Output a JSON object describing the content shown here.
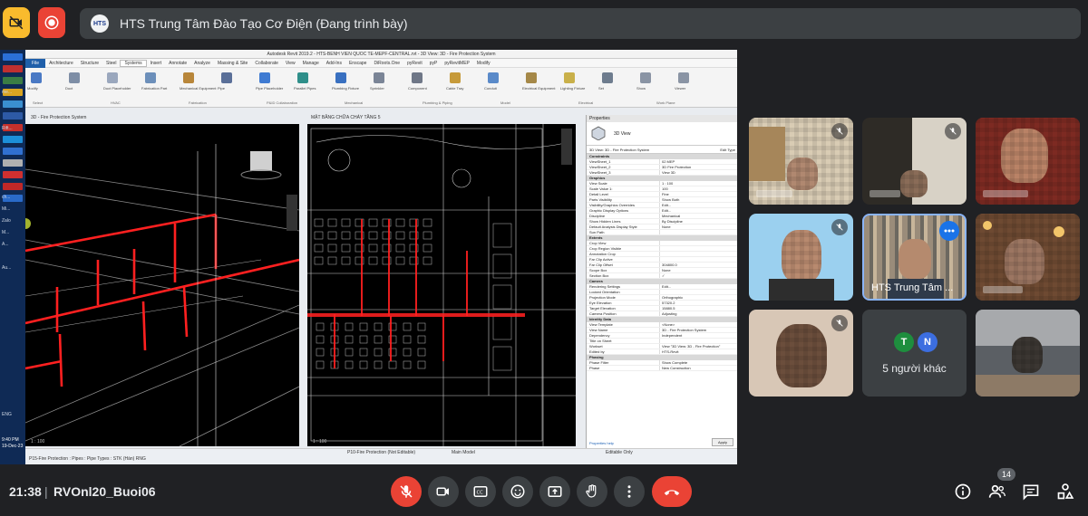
{
  "header": {
    "camera_off_icon": "camera-off-icon",
    "record_icon": "record-icon",
    "presenting_logo": "HTS",
    "presenting_title": "HTS Trung Tâm Đào Tạo Cơ Điện (Đang trình bày)"
  },
  "shared_screen": {
    "window_title": "Autodesk Revit 2019.2 - HTS-BENH VIEN QUOC TE-MEPF-CENTRAL.rvt - 3D View: 3D - Fire Protection System",
    "ribbon_tabs": [
      "File",
      "Architecture",
      "Structure",
      "Steel",
      "Systems",
      "Insert",
      "Annotate",
      "Analyze",
      "Massing & Site",
      "Collaborate",
      "View",
      "Manage",
      "Add-Ins",
      "Enscape",
      "DiRoots.One",
      "pyRevit",
      "pyP",
      "pyRevitMEP",
      "Modify"
    ],
    "active_tab": "Systems",
    "ribbon_tools": [
      "Modify",
      "Duct",
      "Duct Placeholder",
      "Fabrication Part",
      "Mechanical Equipment",
      "Pipe",
      "Pipe Placeholder",
      "Parallel Pipes",
      "Plumbing Fixture",
      "Sprinkler",
      "Component",
      "Cable Tray",
      "Conduit",
      "Electrical Equipment",
      "Lighting Fixture",
      "Set",
      "Show",
      "Viewer"
    ],
    "ribbon_groups": [
      "Select",
      "HVAC",
      "Fabrication",
      "P&ID Collaboration",
      "Mechanical",
      "Plumbing & Piping",
      "Model",
      "Electrical",
      "Work Plane"
    ],
    "view_left_tab": "3D - Fire Protection System",
    "view_right_tab": "MẶT BẰNG CHỮA CHÁY TẦNG 5",
    "properties": {
      "title": "Properties",
      "type_name": "3D View",
      "selector": "3D View: 3D - Fire Protection System",
      "edit_type": "Edit Type",
      "rows": [
        {
          "section": "Constraints"
        },
        {
          "k": "ViewSheet_1",
          "v": "02 MEP"
        },
        {
          "k": "ViewSheet_2",
          "v": "3D Fire Protection"
        },
        {
          "k": "ViewSheet_3",
          "v": "View 3D"
        },
        {
          "section": "Graphics"
        },
        {
          "k": "View Scale",
          "v": "1 : 100"
        },
        {
          "k": "Scale Value 1:",
          "v": "100"
        },
        {
          "k": "Detail Level",
          "v": "Fine"
        },
        {
          "k": "Parts Visibility",
          "v": "Show Both"
        },
        {
          "k": "Visibility/Graphics Overrides",
          "v": "Edit..."
        },
        {
          "k": "Graphic Display Options",
          "v": "Edit..."
        },
        {
          "k": "Discipline",
          "v": "Mechanical"
        },
        {
          "k": "Show Hidden Lines",
          "v": "By Discipline"
        },
        {
          "k": "Default Analysis Display Style",
          "v": "None"
        },
        {
          "k": "Sun Path",
          "v": ""
        },
        {
          "section": "Extents"
        },
        {
          "k": "Crop View",
          "v": ""
        },
        {
          "k": "Crop Region Visible",
          "v": ""
        },
        {
          "k": "Annotation Crop",
          "v": ""
        },
        {
          "k": "Far Clip Active",
          "v": ""
        },
        {
          "k": "Far Clip Offset",
          "v": "304800.0"
        },
        {
          "k": "Scope Box",
          "v": "None"
        },
        {
          "k": "Section Box",
          "v": "✓"
        },
        {
          "section": "Camera"
        },
        {
          "k": "Rendering Settings",
          "v": "Edit..."
        },
        {
          "k": "Locked Orientation",
          "v": ""
        },
        {
          "k": "Projection Mode",
          "v": "Orthographic"
        },
        {
          "k": "Eye Elevation",
          "v": "57320.2"
        },
        {
          "k": "Target Elevation",
          "v": "15880.5"
        },
        {
          "k": "Camera Position",
          "v": "Adjusting"
        },
        {
          "section": "Identity Data"
        },
        {
          "k": "View Template",
          "v": "<None>"
        },
        {
          "k": "View Name",
          "v": "3D - Fire Protection System"
        },
        {
          "k": "Dependency",
          "v": "Independent"
        },
        {
          "k": "Title on Sheet",
          "v": ""
        },
        {
          "k": "Workset",
          "v": "View \"3D View: 3D - Fire Protection\""
        },
        {
          "k": "Edited by",
          "v": "HTS-Revit"
        },
        {
          "section": "Phasing"
        },
        {
          "k": "Phase Filter",
          "v": "Show Complete"
        },
        {
          "k": "Phase",
          "v": "New Construction"
        }
      ],
      "help_link": "Properties help",
      "apply_button": "Apply"
    },
    "scale_left": "1 : 100",
    "scale_right": "1 : 100",
    "status_text": "P15-Fire Protection : Pipes : Pipe Types : STK (Hàn) RNG",
    "status_system": "P10-Fire Protection (Not Editable)",
    "status_model": "Main Model",
    "status_editable": "Editable Only",
    "taskbar_labels": [
      "me...",
      "Rift...",
      "ch...",
      "Mi...",
      "Zalo",
      "M...",
      "A...",
      "Au..."
    ],
    "taskbar_time": "9:40 PM",
    "taskbar_date": "19-Dec-23",
    "taskbar_lang": "ENG"
  },
  "participants": [
    {
      "id": "p1",
      "name": "",
      "muted": true
    },
    {
      "id": "p2",
      "name": "",
      "muted": true
    },
    {
      "id": "p3",
      "name": "",
      "muted": false
    },
    {
      "id": "p4",
      "name": "",
      "muted": true
    },
    {
      "id": "hts",
      "name": "HTS Trung Tâm ...",
      "muted": false,
      "active": true
    },
    {
      "id": "p6",
      "name": "",
      "muted": false
    },
    {
      "id": "p7",
      "name": "",
      "muted": true
    },
    {
      "id": "others",
      "name": "5 người khác",
      "initials": [
        "T",
        "N"
      ],
      "colors": [
        "#1e8e3e",
        "#3c6ee0"
      ]
    },
    {
      "id": "p9",
      "name": "",
      "muted": false
    }
  ],
  "footer": {
    "time": "21:38",
    "separator": "|",
    "meeting_code": "RVOnl20_Buoi06",
    "participant_count": "14"
  },
  "colors": {
    "background": "#202124",
    "control": "#3c4043",
    "danger": "#ea4335",
    "accent": "#8ab4f8",
    "camera_warn": "#f9bb2d"
  }
}
